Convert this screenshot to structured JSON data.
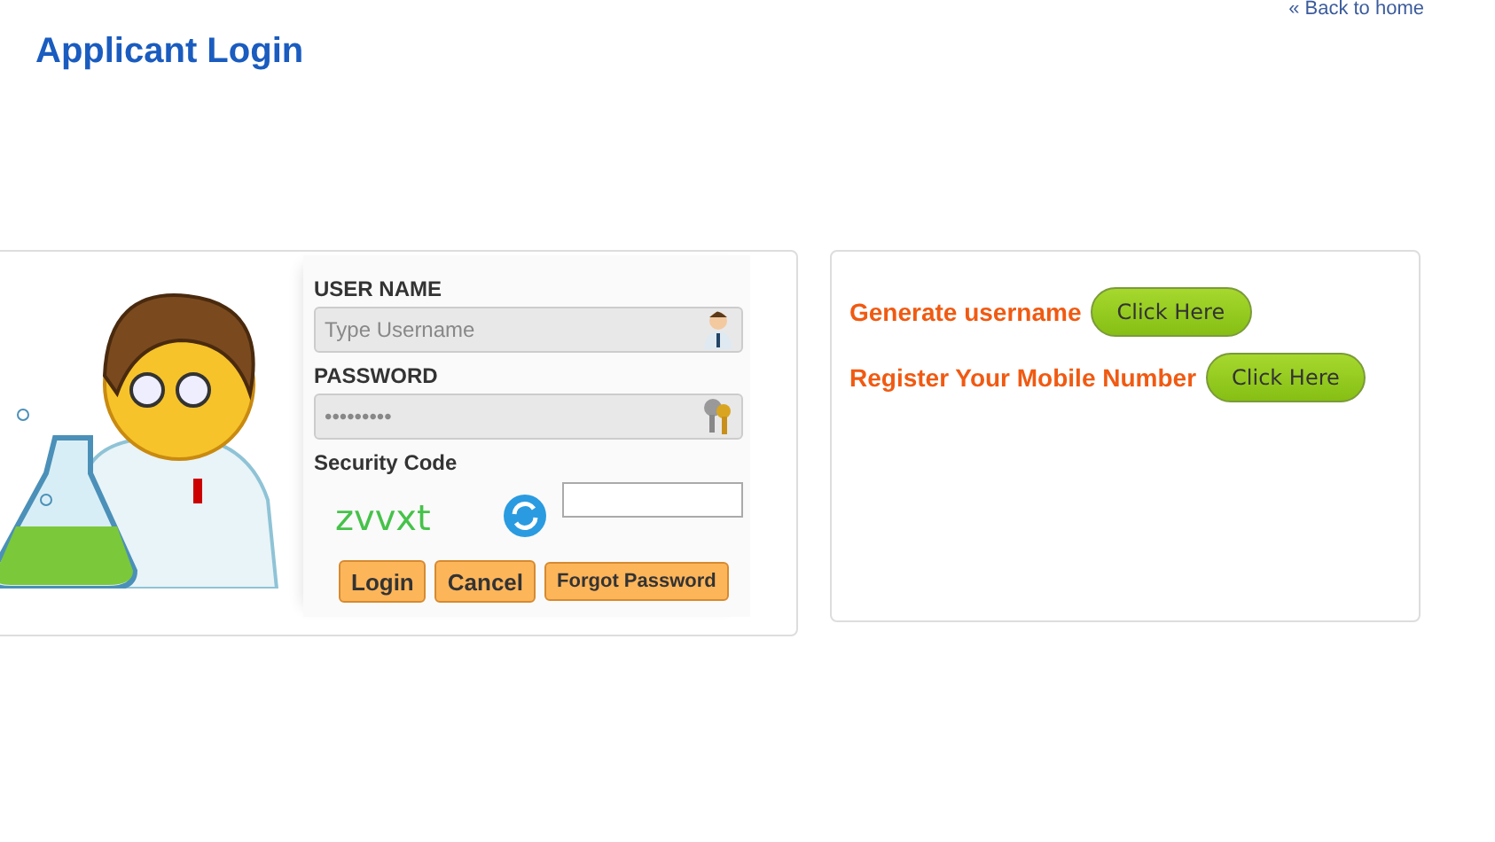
{
  "back_link": "« Back to home",
  "title": "Applicant Login",
  "login": {
    "username_label": "USER NAME",
    "username": {
      "placeholder": "Type Username"
    },
    "password_label": "PASSWORD",
    "password": {
      "placeholder": "•••••••••"
    },
    "security_label": "Security Code",
    "captcha": "zvvxt",
    "buttons": [
      {
        "label": "Login",
        "kind": "large"
      },
      {
        "label": "Cancel",
        "kind": "large"
      },
      {
        "label": "Forgot Password",
        "kind": "small"
      }
    ]
  },
  "links": [
    {
      "label": "Generate username",
      "button": "Click Here"
    },
    {
      "label": "Register Your Mobile Number",
      "button": "Click Here"
    }
  ]
}
